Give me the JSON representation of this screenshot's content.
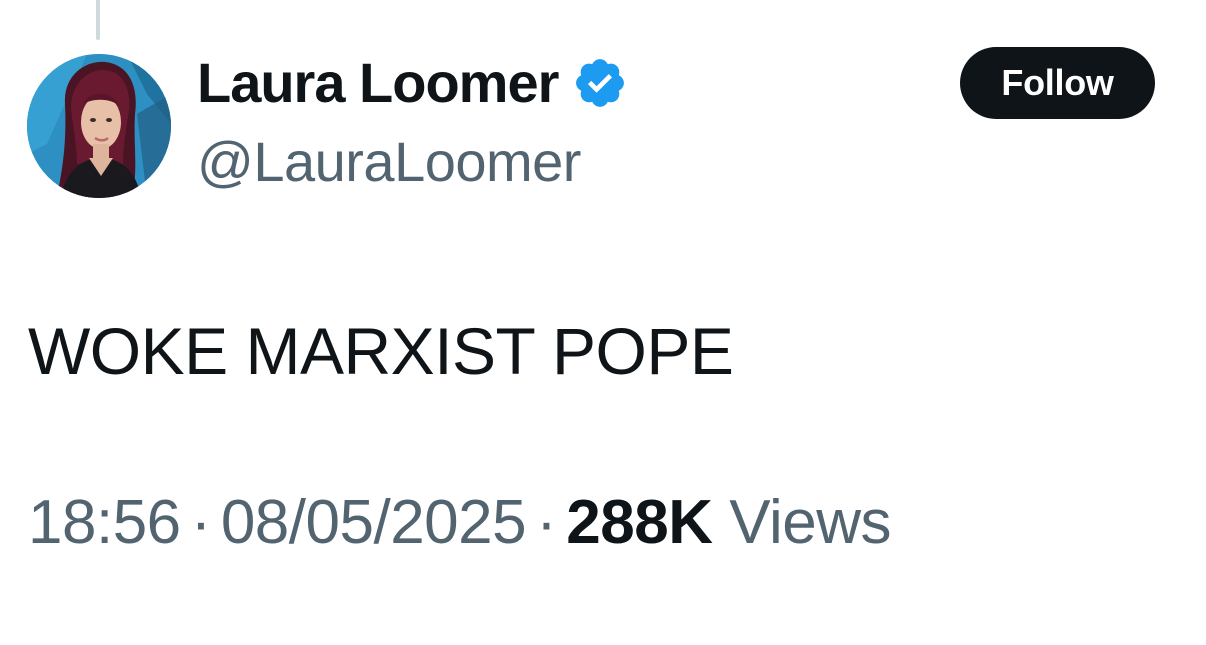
{
  "tweet": {
    "author": {
      "display_name": "Laura Loomer",
      "handle": "@LauraLoomer",
      "verified": true,
      "verified_icon": "verified-badge-icon",
      "avatar": "profile-photo"
    },
    "follow_label": "Follow",
    "text": "WOKE MARXIST POPE",
    "time": "18:56",
    "date": "08/05/2025",
    "separator": "·",
    "views_count": "288K",
    "views_label": "Views"
  },
  "colors": {
    "text_primary": "#0f1419",
    "text_secondary": "#536471",
    "verified_blue": "#1d9bf0",
    "button_bg": "#0f1419",
    "thread_line": "#cfd9de"
  }
}
